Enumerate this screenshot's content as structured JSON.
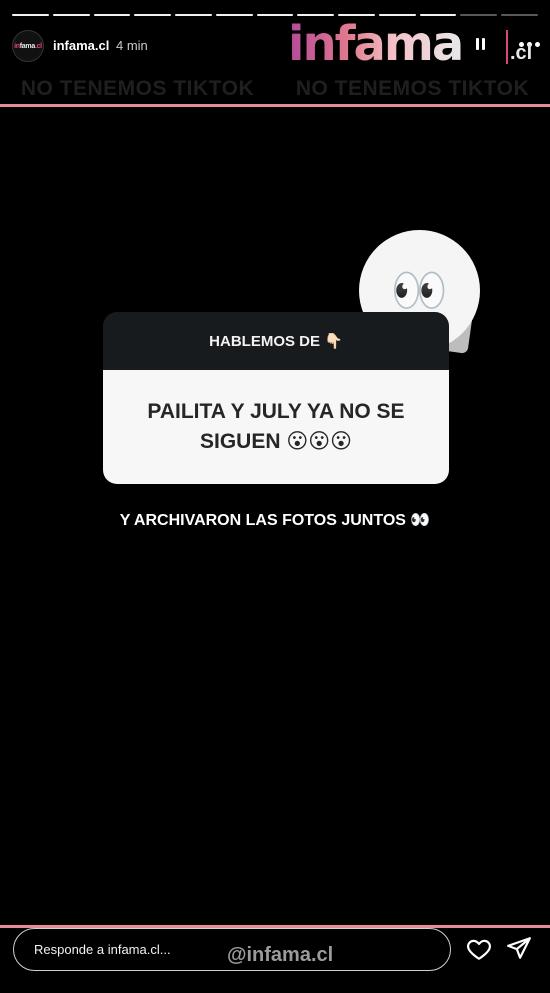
{
  "story": {
    "segments_total": 13,
    "segments_done": 11,
    "username": "infama.cl",
    "time_ago": "4 min",
    "avatar_text": "infama.cl"
  },
  "brand": {
    "logo_main": "infama",
    "logo_tld": ".cl",
    "banner_text": "NO TENEMOS TIKTOK",
    "accent_pink": "#e58c97"
  },
  "question": {
    "header": "HABLEMOS DE 👇🏻",
    "body": "PAILITA Y JULY YA NO SE SIGUEN 😮😮😮"
  },
  "sticker": {
    "emoji": "👀"
  },
  "caption": "Y ARCHIVARON LAS FOTOS JUNTOS 👀",
  "footer": {
    "reply_placeholder": "Responde a infama.cl...",
    "watermark": "@infama.cl"
  }
}
